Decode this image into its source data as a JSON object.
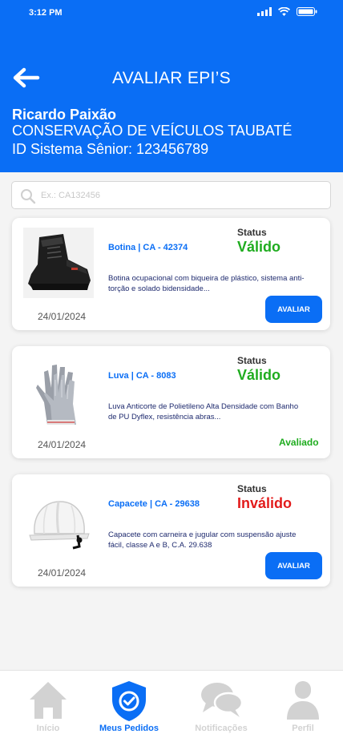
{
  "status_bar": {
    "time": "3:12 PM"
  },
  "header": {
    "title": "AVALIAR EPI’S",
    "user_name": "Ricardo Paixão",
    "organization": "CONSERVAÇÃO DE VEÍCULOS TAUBATÉ",
    "system_id": "ID Sistema Sênior: 123456789"
  },
  "search": {
    "placeholder": "Ex.: CA132456",
    "value": ""
  },
  "status_label": "Status",
  "items": [
    {
      "name": "Botina | CA - 42374",
      "status": "Válido",
      "description": "Botina ocupacional com biqueira de plástico, sistema anti-torção e solado bidensidade...",
      "date": "24/01/2024",
      "action": "AVALIAR",
      "icon": "boot-icon"
    },
    {
      "name": "Luva | CA - 8083",
      "status": "Válido",
      "description": "Luva Anticorte de Polietileno Alta Densidade com Banho de PU Dyflex, resistência abras...",
      "date": "24/01/2024",
      "evaluated": "Avaliado",
      "icon": "glove-icon"
    },
    {
      "name": "Capacete | CA - 29638",
      "status": "Inválido",
      "description": "Capacete com carneira e jugular com  suspensão ajuste fácil, classe A e B, C.A. 29.638",
      "date": "24/01/2024",
      "action": "AVALIAR",
      "icon": "helmet-icon"
    }
  ],
  "nav": [
    {
      "label": "Início",
      "icon": "home-icon"
    },
    {
      "label": "Meus Pedidos",
      "icon": "shield-check-icon",
      "active": true
    },
    {
      "label": "Notificações",
      "icon": "chat-bubbles-icon"
    },
    {
      "label": "Perfil",
      "icon": "user-icon"
    }
  ],
  "colors": {
    "primary": "#0a6ef5",
    "valid": "#1fac1f",
    "invalid": "#e21b1b",
    "nav_inactive": "#d2d2d2"
  }
}
